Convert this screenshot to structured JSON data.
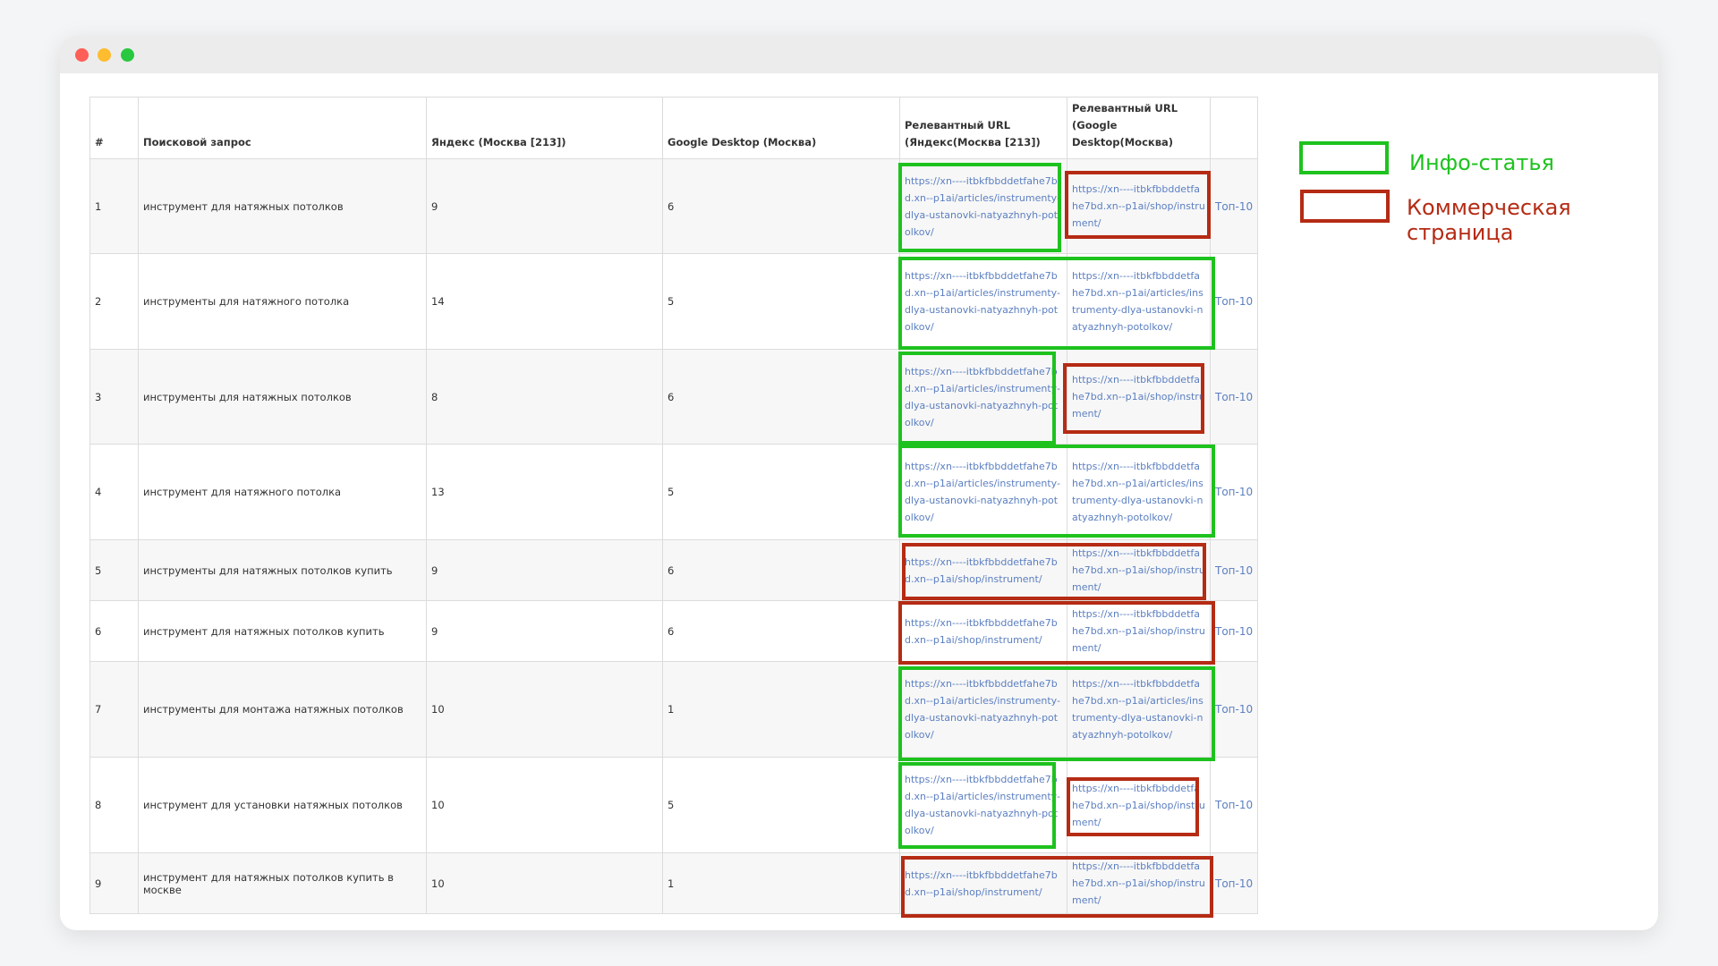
{
  "table": {
    "headers": [
      "#",
      "Поисковой запрос",
      "Яндекс (Москва [213])",
      "Google Desktop (Москва)",
      "Релевантный URL (Яндекс(Москва [213])",
      "Релевантный URL (Google Desktop(Москва)",
      ""
    ],
    "rows": [
      {
        "num": "1",
        "query": "инструмент для натяжных потолков",
        "yandex": "9",
        "google": "6",
        "url_yandex": "https://xn----itbkfbbddetfahe7bd.xn--p1ai/articles/instrumenty-dlya-ustanovki-natyazhnyh-potolkov/",
        "url_google": "https://xn----itbkfbbddetfahe7bd.xn--p1ai/shop/instrument/",
        "top": "Топ-10"
      },
      {
        "num": "2",
        "query": "инструменты для натяжного потолка",
        "yandex": "14",
        "google": "5",
        "url_yandex": "https://xn----itbkfbbddetfahe7bd.xn--p1ai/articles/instrumenty-dlya-ustanovki-natyazhnyh-potolkov/",
        "url_google": "https://xn----itbkfbbddetfahe7bd.xn--p1ai/articles/instrumenty-dlya-ustanovki-natyazhnyh-potolkov/",
        "top": "Топ-10"
      },
      {
        "num": "3",
        "query": "инструменты для натяжных потолков",
        "yandex": "8",
        "google": "6",
        "url_yandex": "https://xn----itbkfbbddetfahe7bd.xn--p1ai/articles/instrumenty-dlya-ustanovki-natyazhnyh-potolkov/",
        "url_google": "https://xn----itbkfbbddetfahe7bd.xn--p1ai/shop/instrument/",
        "top": "Топ-10"
      },
      {
        "num": "4",
        "query": "инструмент для натяжного потолка",
        "yandex": "13",
        "google": "5",
        "url_yandex": "https://xn----itbkfbbddetfahe7bd.xn--p1ai/articles/instrumenty-dlya-ustanovki-natyazhnyh-potolkov/",
        "url_google": "https://xn----itbkfbbddetfahe7bd.xn--p1ai/articles/instrumenty-dlya-ustanovki-natyazhnyh-potolkov/",
        "top": "Топ-10"
      },
      {
        "num": "5",
        "query": "инструменты для натяжных потолков купить",
        "yandex": "9",
        "google": "6",
        "url_yandex": "https://xn----itbkfbbddetfahe7bd.xn--p1ai/shop/instrument/",
        "url_google": "https://xn----itbkfbbddetfahe7bd.xn--p1ai/shop/instrument/",
        "top": "Топ-10"
      },
      {
        "num": "6",
        "query": "инструмент для натяжных потолков купить",
        "yandex": "9",
        "google": "6",
        "url_yandex": "https://xn----itbkfbbddetfahe7bd.xn--p1ai/shop/instrument/",
        "url_google": "https://xn----itbkfbbddetfahe7bd.xn--p1ai/shop/instrument/",
        "top": "Топ-10"
      },
      {
        "num": "7",
        "query": "инструменты для монтажа натяжных потолков",
        "yandex": "10",
        "google": "1",
        "url_yandex": "https://xn----itbkfbbddetfahe7bd.xn--p1ai/articles/instrumenty-dlya-ustanovki-natyazhnyh-potolkov/",
        "url_google": "https://xn----itbkfbbddetfahe7bd.xn--p1ai/articles/instrumenty-dlya-ustanovki-natyazhnyh-potolkov/",
        "top": "Топ-10"
      },
      {
        "num": "8",
        "query": "инструмент для установки натяжных потолков",
        "yandex": "10",
        "google": "5",
        "url_yandex": "https://xn----itbkfbbddetfahe7bd.xn--p1ai/articles/instrumenty-dlya-ustanovki-natyazhnyh-potolkov/",
        "url_google": "https://xn----itbkfbbddetfahe7bd.xn--p1ai/shop/instrument/",
        "top": "Топ-10"
      },
      {
        "num": "9",
        "query": "инструмент для натяжных потолков купить в москве",
        "yandex": "10",
        "google": "1",
        "url_yandex": "https://xn----itbkfbbddetfahe7bd.xn--p1ai/shop/instrument/",
        "url_google": "https://xn----itbkfbbddetfahe7bd.xn--p1ai/shop/instrument/",
        "top": "Топ-10"
      }
    ]
  },
  "legend": {
    "info_label": "Инфо-статья",
    "info_color": "#1ec21e",
    "commercial_label": "Коммерческая страница",
    "commercial_color": "#b52b14"
  },
  "colors": {
    "link": "#5b7fc1",
    "window_bg": "#ffffff",
    "page_bg": "#f4f5f6"
  }
}
